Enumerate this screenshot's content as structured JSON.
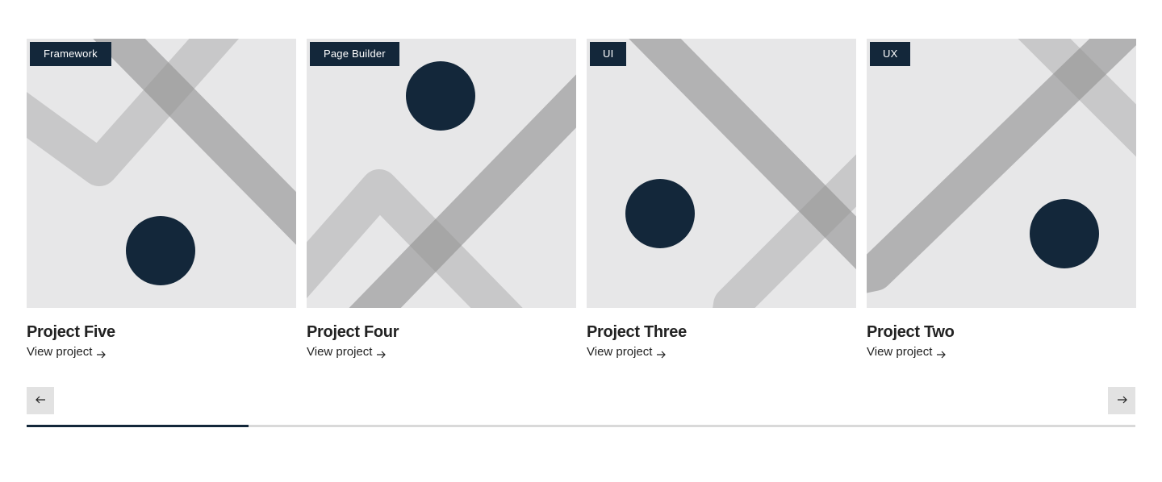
{
  "cards": [
    {
      "tag": "Framework",
      "title": "Project Five",
      "link": "View project"
    },
    {
      "tag": "Page Builder",
      "title": "Project Four",
      "link": "View project"
    },
    {
      "tag": "UI",
      "title": "Project Three",
      "link": "View project"
    },
    {
      "tag": "UX",
      "title": "Project Two",
      "link": "View project"
    }
  ],
  "icons": {
    "card_link": "arrow-right-icon",
    "prev": "arrow-left-icon",
    "next": "arrow-right-icon"
  },
  "colors": {
    "accent": "#13273a",
    "thumb_bg": "#e7e7e8",
    "stripe_dark": "#a6a6a6",
    "stripe_light": "#c4c4c4",
    "track": "#d9d9d9"
  },
  "scroll_progress": 0.2
}
